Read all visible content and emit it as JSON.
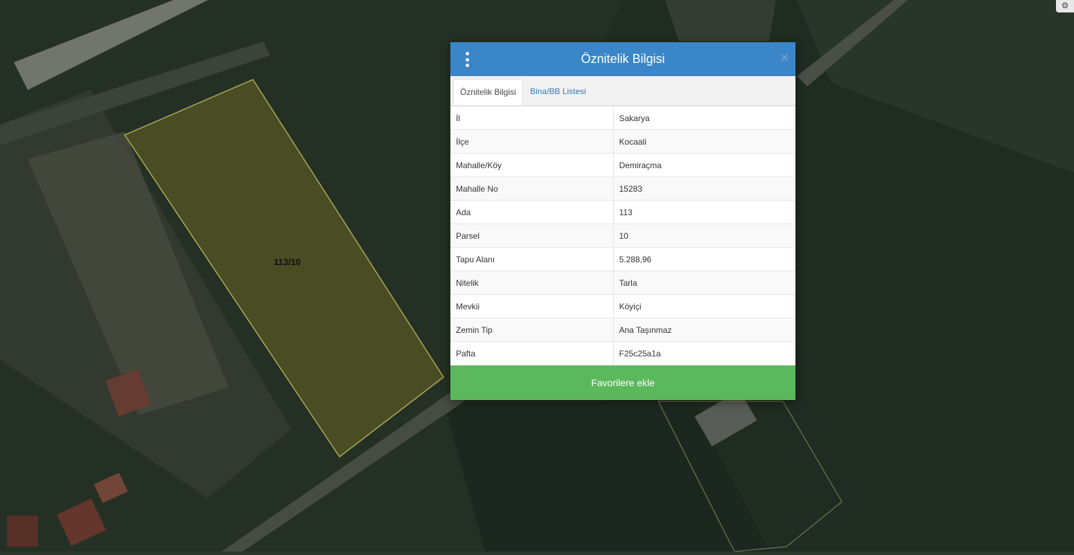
{
  "map": {
    "parcel_label": "113/10",
    "colors": {
      "parcel_outline": "#c9c96a",
      "parcel_fill": "#6b6a2c",
      "background": "#2b3a2c"
    }
  },
  "modal": {
    "title": "Öznitelik Bilgisi",
    "menu_icon": "vertical-ellipsis-icon",
    "close_icon": "close-icon",
    "tabs": [
      {
        "label": "Öznitelik Bilgisi",
        "active": true
      },
      {
        "label": "Bina/BB Listesi",
        "active": false
      }
    ],
    "rows": [
      {
        "key": "İl",
        "value": "Sakarya"
      },
      {
        "key": "İlçe",
        "value": "Kocaali"
      },
      {
        "key": "Mahalle/Köy",
        "value": "Demiraçma"
      },
      {
        "key": "Mahalle No",
        "value": "15283"
      },
      {
        "key": "Ada",
        "value": "113"
      },
      {
        "key": "Parsel",
        "value": "10"
      },
      {
        "key": "Tapu Alanı",
        "value": "5.288,96"
      },
      {
        "key": "Nitelik",
        "value": "Tarla"
      },
      {
        "key": "Mevkii",
        "value": "Köyiçi"
      },
      {
        "key": "Zemin Tip",
        "value": "Ana Taşınmaz"
      },
      {
        "key": "Pafta",
        "value": "F25c25a1a"
      }
    ],
    "favorite_button": "Favorilere ekle",
    "colors": {
      "header": "#3a86c8",
      "button": "#5cb85c",
      "link": "#337ab7"
    }
  }
}
